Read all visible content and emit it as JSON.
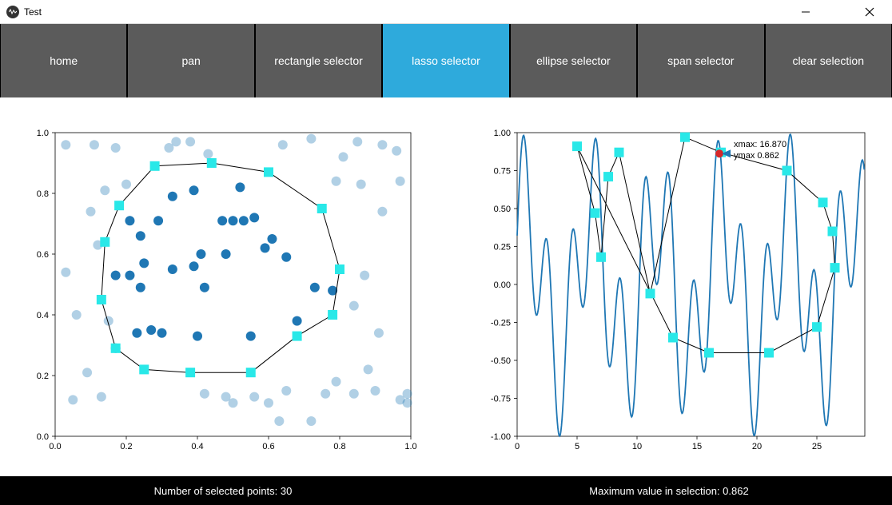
{
  "window": {
    "title": "Test"
  },
  "toolbar": {
    "items": [
      {
        "label": "home",
        "active": false
      },
      {
        "label": "pan",
        "active": false
      },
      {
        "label": "rectangle selector",
        "active": false
      },
      {
        "label": "lasso selector",
        "active": true
      },
      {
        "label": "ellipse selector",
        "active": false
      },
      {
        "label": "span selector",
        "active": false
      },
      {
        "label": "clear selection",
        "active": false
      }
    ]
  },
  "status": {
    "selected_label": "Number of selected points: 30",
    "max_label": "Maximum value in selection: 0.862"
  },
  "annotations": {
    "xmax": "xmax: 16.870",
    "ymax": "ymax 0.862"
  },
  "chart_data": [
    {
      "type": "scatter",
      "xlabel": "",
      "ylabel": "",
      "xlim": [
        0.0,
        1.0
      ],
      "ylim": [
        0.0,
        1.0
      ],
      "xticks": [
        0.0,
        0.2,
        0.4,
        0.6,
        0.8,
        1.0
      ],
      "yticks": [
        0.0,
        0.2,
        0.4,
        0.6,
        0.8,
        1.0
      ],
      "data_points": [
        {
          "x": 0.03,
          "y": 0.96,
          "selected": false
        },
        {
          "x": 0.06,
          "y": 0.4,
          "selected": false
        },
        {
          "x": 0.05,
          "y": 0.12,
          "selected": false
        },
        {
          "x": 0.11,
          "y": 0.96,
          "selected": false
        },
        {
          "x": 0.1,
          "y": 0.74,
          "selected": false
        },
        {
          "x": 0.14,
          "y": 0.81,
          "selected": false
        },
        {
          "x": 0.09,
          "y": 0.21,
          "selected": false
        },
        {
          "x": 0.13,
          "y": 0.13,
          "selected": false
        },
        {
          "x": 0.15,
          "y": 0.38,
          "selected": false
        },
        {
          "x": 0.17,
          "y": 0.95,
          "selected": false
        },
        {
          "x": 0.2,
          "y": 0.83,
          "selected": false
        },
        {
          "x": 0.17,
          "y": 0.29,
          "selected": true
        },
        {
          "x": 0.21,
          "y": 0.71,
          "selected": true
        },
        {
          "x": 0.21,
          "y": 0.53,
          "selected": true
        },
        {
          "x": 0.24,
          "y": 0.66,
          "selected": true
        },
        {
          "x": 0.25,
          "y": 0.57,
          "selected": true
        },
        {
          "x": 0.23,
          "y": 0.34,
          "selected": true
        },
        {
          "x": 0.24,
          "y": 0.49,
          "selected": true
        },
        {
          "x": 0.27,
          "y": 0.35,
          "selected": true
        },
        {
          "x": 0.3,
          "y": 0.34,
          "selected": true
        },
        {
          "x": 0.29,
          "y": 0.71,
          "selected": true
        },
        {
          "x": 0.33,
          "y": 0.79,
          "selected": true
        },
        {
          "x": 0.32,
          "y": 0.95,
          "selected": false
        },
        {
          "x": 0.34,
          "y": 0.97,
          "selected": false
        },
        {
          "x": 0.33,
          "y": 0.55,
          "selected": true
        },
        {
          "x": 0.38,
          "y": 0.97,
          "selected": false
        },
        {
          "x": 0.39,
          "y": 0.81,
          "selected": true
        },
        {
          "x": 0.39,
          "y": 0.56,
          "selected": true
        },
        {
          "x": 0.41,
          "y": 0.6,
          "selected": true
        },
        {
          "x": 0.4,
          "y": 0.33,
          "selected": true
        },
        {
          "x": 0.42,
          "y": 0.49,
          "selected": true
        },
        {
          "x": 0.47,
          "y": 0.71,
          "selected": true
        },
        {
          "x": 0.48,
          "y": 0.6,
          "selected": true
        },
        {
          "x": 0.5,
          "y": 0.71,
          "selected": true
        },
        {
          "x": 0.52,
          "y": 0.82,
          "selected": true
        },
        {
          "x": 0.53,
          "y": 0.71,
          "selected": true
        },
        {
          "x": 0.56,
          "y": 0.72,
          "selected": true
        },
        {
          "x": 0.55,
          "y": 0.33,
          "selected": true
        },
        {
          "x": 0.59,
          "y": 0.62,
          "selected": true
        },
        {
          "x": 0.61,
          "y": 0.65,
          "selected": true
        },
        {
          "x": 0.65,
          "y": 0.59,
          "selected": true
        },
        {
          "x": 0.68,
          "y": 0.38,
          "selected": true
        },
        {
          "x": 0.73,
          "y": 0.49,
          "selected": true
        },
        {
          "x": 0.78,
          "y": 0.48,
          "selected": true
        },
        {
          "x": 0.79,
          "y": 0.84,
          "selected": false
        },
        {
          "x": 0.81,
          "y": 0.92,
          "selected": false
        },
        {
          "x": 0.85,
          "y": 0.97,
          "selected": false
        },
        {
          "x": 0.86,
          "y": 0.83,
          "selected": false
        },
        {
          "x": 0.84,
          "y": 0.43,
          "selected": false
        },
        {
          "x": 0.84,
          "y": 0.14,
          "selected": false
        },
        {
          "x": 0.88,
          "y": 0.22,
          "selected": false
        },
        {
          "x": 0.87,
          "y": 0.53,
          "selected": false
        },
        {
          "x": 0.9,
          "y": 0.15,
          "selected": false
        },
        {
          "x": 0.91,
          "y": 0.34,
          "selected": false
        },
        {
          "x": 0.92,
          "y": 0.74,
          "selected": false
        },
        {
          "x": 0.92,
          "y": 0.96,
          "selected": false
        },
        {
          "x": 0.96,
          "y": 0.94,
          "selected": false
        },
        {
          "x": 0.97,
          "y": 0.84,
          "selected": false
        },
        {
          "x": 0.97,
          "y": 0.12,
          "selected": false
        },
        {
          "x": 0.99,
          "y": 0.11,
          "selected": false
        },
        {
          "x": 0.99,
          "y": 0.14,
          "selected": false
        },
        {
          "x": 0.03,
          "y": 0.54,
          "selected": false
        },
        {
          "x": 0.42,
          "y": 0.14,
          "selected": false
        },
        {
          "x": 0.48,
          "y": 0.13,
          "selected": false
        },
        {
          "x": 0.5,
          "y": 0.11,
          "selected": false
        },
        {
          "x": 0.56,
          "y": 0.13,
          "selected": false
        },
        {
          "x": 0.6,
          "y": 0.11,
          "selected": false
        },
        {
          "x": 0.63,
          "y": 0.05,
          "selected": false
        },
        {
          "x": 0.72,
          "y": 0.05,
          "selected": false
        },
        {
          "x": 0.65,
          "y": 0.15,
          "selected": false
        },
        {
          "x": 0.17,
          "y": 0.53,
          "selected": true
        },
        {
          "x": 0.76,
          "y": 0.14,
          "selected": false
        },
        {
          "x": 0.79,
          "y": 0.18,
          "selected": false
        },
        {
          "x": 0.64,
          "y": 0.96,
          "selected": false
        },
        {
          "x": 0.72,
          "y": 0.98,
          "selected": false
        },
        {
          "x": 0.43,
          "y": 0.93,
          "selected": false
        },
        {
          "x": 0.12,
          "y": 0.63,
          "selected": false
        }
      ],
      "lasso_vertices": [
        {
          "x": 0.18,
          "y": 0.76
        },
        {
          "x": 0.28,
          "y": 0.89
        },
        {
          "x": 0.44,
          "y": 0.9
        },
        {
          "x": 0.6,
          "y": 0.87
        },
        {
          "x": 0.75,
          "y": 0.75
        },
        {
          "x": 0.8,
          "y": 0.55
        },
        {
          "x": 0.78,
          "y": 0.4
        },
        {
          "x": 0.68,
          "y": 0.33
        },
        {
          "x": 0.55,
          "y": 0.21
        },
        {
          "x": 0.38,
          "y": 0.21
        },
        {
          "x": 0.25,
          "y": 0.22
        },
        {
          "x": 0.17,
          "y": 0.29
        },
        {
          "x": 0.13,
          "y": 0.45
        },
        {
          "x": 0.14,
          "y": 0.64
        }
      ]
    },
    {
      "type": "line",
      "xlabel": "",
      "ylabel": "",
      "xlim": [
        0,
        29
      ],
      "ylim": [
        -1.0,
        1.0
      ],
      "xticks": [
        0,
        5,
        10,
        15,
        20,
        25
      ],
      "yticks": [
        -1.0,
        -0.75,
        -0.5,
        -0.25,
        0.0,
        0.25,
        0.5,
        0.75,
        1.0
      ],
      "max_marker": {
        "x": 16.87,
        "y": 0.862
      },
      "lasso_vertices": [
        {
          "x": 5.0,
          "y": 0.91
        },
        {
          "x": 6.5,
          "y": 0.47
        },
        {
          "x": 7.0,
          "y": 0.18
        },
        {
          "x": 7.6,
          "y": 0.71
        },
        {
          "x": 8.5,
          "y": 0.87
        },
        {
          "x": 11.1,
          "y": -0.06
        },
        {
          "x": 14.0,
          "y": 0.97
        },
        {
          "x": 17.0,
          "y": 0.87
        },
        {
          "x": 22.5,
          "y": 0.75
        },
        {
          "x": 25.5,
          "y": 0.54
        },
        {
          "x": 26.3,
          "y": 0.35
        },
        {
          "x": 26.5,
          "y": 0.11
        },
        {
          "x": 25.0,
          "y": -0.28
        },
        {
          "x": 21.0,
          "y": -0.45
        },
        {
          "x": 16.0,
          "y": -0.45
        },
        {
          "x": 13.0,
          "y": -0.35
        }
      ]
    }
  ]
}
